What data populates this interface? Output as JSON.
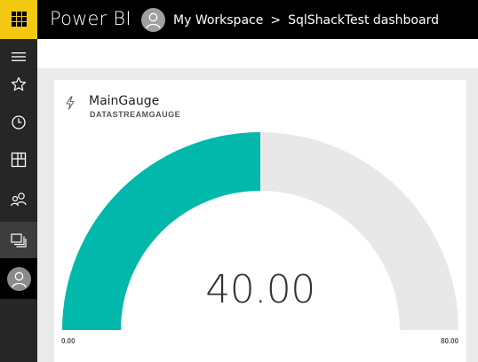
{
  "header": {
    "app_title": "Power BI",
    "breadcrumb": {
      "workspace": "My Workspace",
      "separator": ">",
      "dashboard": "SqlShackTest dashboard"
    }
  },
  "nav_rail": {
    "items": [
      {
        "name": "nav-menu",
        "icon": "hamburger-icon"
      },
      {
        "name": "favorites",
        "icon": "star-icon"
      },
      {
        "name": "recent",
        "icon": "clock-icon"
      },
      {
        "name": "apps",
        "icon": "apps-icon"
      },
      {
        "name": "shared-with-me",
        "icon": "people-icon"
      },
      {
        "name": "workspaces",
        "icon": "workspaces-icon"
      },
      {
        "name": "profile",
        "icon": "user-avatar-icon"
      }
    ]
  },
  "tile": {
    "icon": "lightning-icon",
    "title": "MainGauge",
    "subtitle": "DATASTREAMGAUGE",
    "gauge": {
      "value": 40,
      "value_label": "40.00",
      "min": 0,
      "max": 80,
      "min_label": "0.00",
      "max_label": "80.00",
      "fill_color": "#01b8aa",
      "track_color": "#e8e8e8"
    }
  },
  "colors": {
    "topbar": "#000000",
    "launcher": "#f2c811",
    "rail": "#262626"
  }
}
